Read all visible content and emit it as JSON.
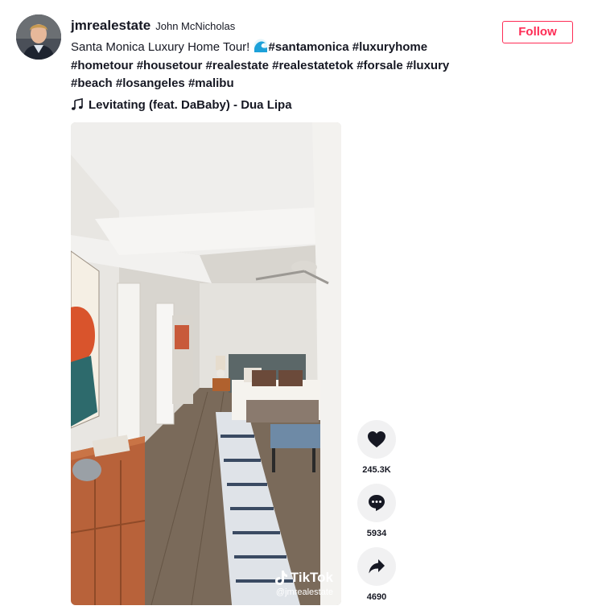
{
  "author": {
    "username": "jmrealestate",
    "full_name": "John McNicholas",
    "avatar_icon": "avatar-photo"
  },
  "follow_label": "Follow",
  "caption": {
    "text": "Santa Monica Luxury Home Tour!",
    "emoji_icon": "wave-emoji-icon",
    "hashtags": [
      "#santamonica",
      "#luxuryhome",
      "#hometour",
      "#housetour",
      "#realestate",
      "#realestatetok",
      "#forsale",
      "#luxury",
      "#beach",
      "#losangeles",
      "#malibu"
    ]
  },
  "music": {
    "icon": "music-note-icon",
    "title": "Levitating (feat. DaBaby) - Dua Lipa"
  },
  "video": {
    "watermark_logo": "TikTok",
    "watermark_handle": "@jmrealestate"
  },
  "actions": {
    "like": {
      "icon": "heart-icon",
      "count": "245.3K"
    },
    "comment": {
      "icon": "comment-icon",
      "count": "5934"
    },
    "share": {
      "icon": "share-icon",
      "count": "4690"
    }
  },
  "colors": {
    "accent": "#fe2c55",
    "text": "#161823",
    "action_bg": "#f1f1f2"
  }
}
